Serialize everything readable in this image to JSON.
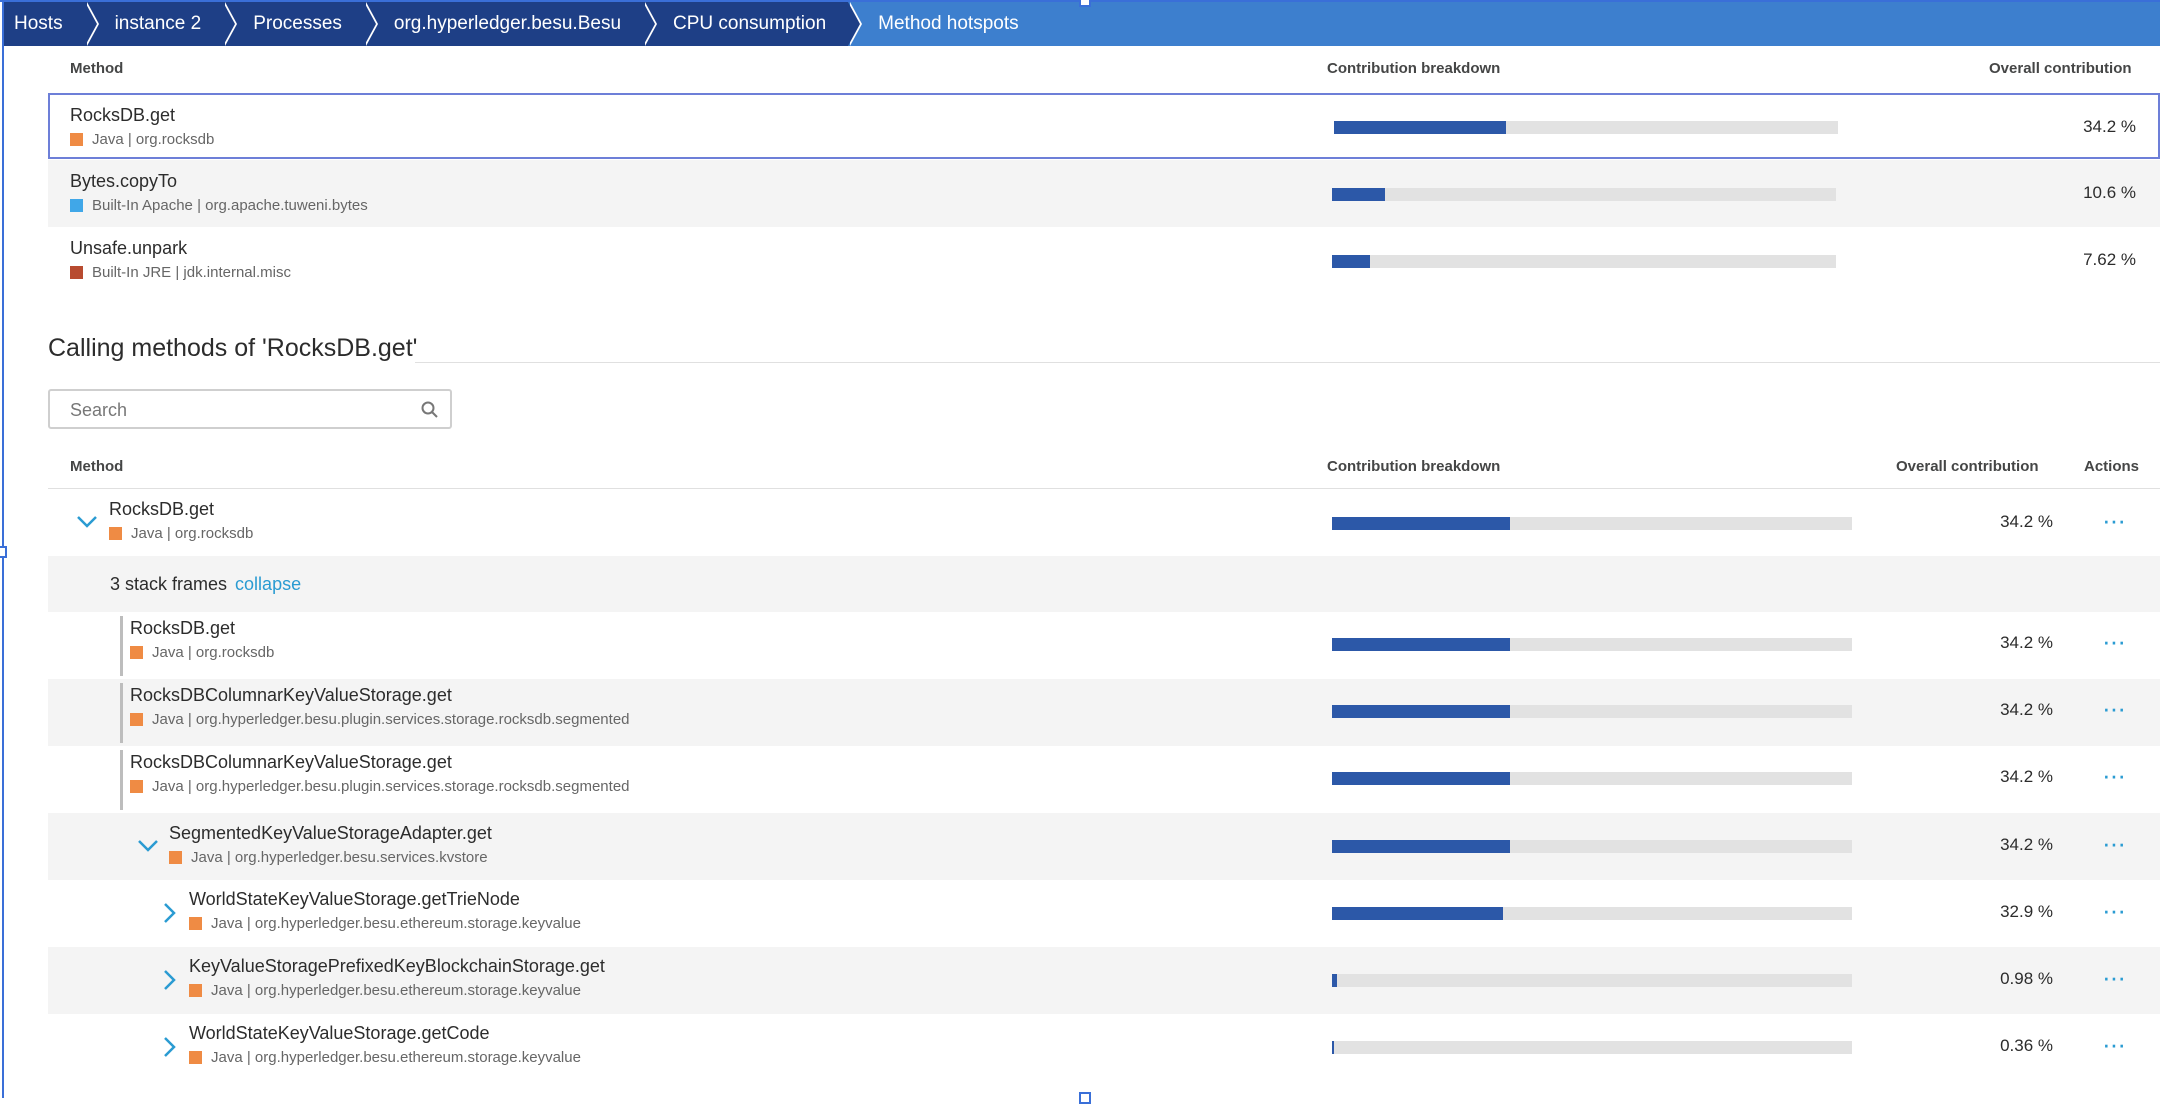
{
  "breadcrumb": [
    "Hosts",
    "instance 2",
    "Processes",
    "org.hyperledger.besu.Besu",
    "CPU consumption",
    "Method hotspots"
  ],
  "top_table": {
    "headers": {
      "method": "Method",
      "breakdown": "Contribution breakdown",
      "overall": "Overall contribution"
    },
    "rows": [
      {
        "name": "RocksDB.get",
        "sub": "Java | org.rocksdb",
        "color": "#ef8b44",
        "fraction": 0.342,
        "pct": "34.2 %"
      },
      {
        "name": "Bytes.copyTo",
        "sub": "Built-In Apache | org.apache.tuweni.bytes",
        "color": "#40a7e8",
        "fraction": 0.106,
        "pct": "10.6 %"
      },
      {
        "name": "Unsafe.unpark",
        "sub": "Built-In JRE | jdk.internal.misc",
        "color": "#b84b30",
        "fraction": 0.0762,
        "pct": "7.62 %"
      }
    ]
  },
  "calling_title": "Calling methods of 'RocksDB.get'",
  "search_placeholder": "Search",
  "bottom_table": {
    "headers": {
      "method": "Method",
      "breakdown": "Contribution breakdown",
      "overall": "Overall contribution",
      "actions": "Actions"
    },
    "root": {
      "name": "RocksDB.get",
      "sub": "Java | org.rocksdb",
      "color": "#ef8b44",
      "fraction": 0.342,
      "pct": "34.2 %"
    },
    "stack_frames_label": "3 stack frames",
    "collapse_label": "collapse",
    "frames": [
      {
        "name": "RocksDB.get",
        "sub": "Java | org.rocksdb",
        "color": "#ef8b44",
        "fraction": 0.342,
        "pct": "34.2 %"
      },
      {
        "name": "RocksDBColumnarKeyValueStorage.get",
        "sub": "Java | org.hyperledger.besu.plugin.services.storage.rocksdb.segmented",
        "color": "#ef8b44",
        "fraction": 0.342,
        "pct": "34.2 %"
      },
      {
        "name": "RocksDBColumnarKeyValueStorage.get",
        "sub": "Java | org.hyperledger.besu.plugin.services.storage.rocksdb.segmented",
        "color": "#ef8b44",
        "fraction": 0.342,
        "pct": "34.2 %"
      }
    ],
    "adapter": {
      "name": "SegmentedKeyValueStorageAdapter.get",
      "sub": "Java | org.hyperledger.besu.services.kvstore",
      "color": "#ef8b44",
      "fraction": 0.342,
      "pct": "34.2 %"
    },
    "children": [
      {
        "name": "WorldStateKeyValueStorage.getTrieNode",
        "sub": "Java | org.hyperledger.besu.ethereum.storage.keyvalue",
        "color": "#ef8b44",
        "fraction": 0.329,
        "pct": "32.9 %"
      },
      {
        "name": "KeyValueStoragePrefixedKeyBlockchainStorage.get",
        "sub": "Java | org.hyperledger.besu.ethereum.storage.keyvalue",
        "color": "#ef8b44",
        "fraction": 0.0098,
        "pct": "0.98 %"
      },
      {
        "name": "WorldStateKeyValueStorage.getCode",
        "sub": "Java | org.hyperledger.besu.ethereum.storage.keyvalue",
        "color": "#ef8b44",
        "fraction": 0.0036,
        "pct": "0.36 %"
      }
    ]
  }
}
